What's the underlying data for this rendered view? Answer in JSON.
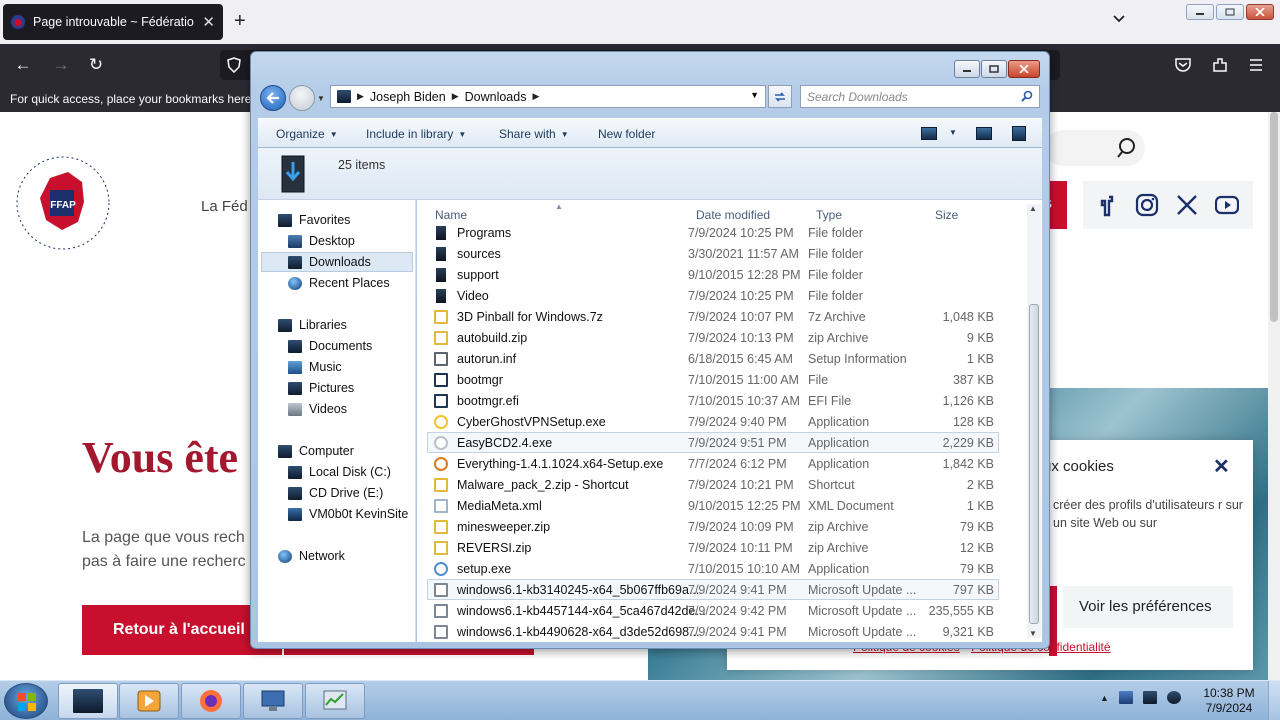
{
  "browser": {
    "tab_title": "Page introuvable ~ Fédération f",
    "tab_close": "✕",
    "new_tab": "+",
    "bookmark_hint": "For quick access, place your bookmarks here o"
  },
  "webpage": {
    "tagline": "La Féd",
    "top_red_button": "s",
    "hero_title": "Vous ête",
    "hero_text": "La page que vous rech pas à faire une recherc",
    "home_button": "Retour à l'accueil",
    "cookie": {
      "title": "ux cookies",
      "close": "✕",
      "text": "créer des profils d'utilisateurs r sur un site Web ou sur",
      "preferences_button": "Voir les préférences",
      "link_cookies": "Politique de cookies",
      "link_privacy": "Politique de confidentialité"
    }
  },
  "explorer": {
    "breadcrumb": [
      "Joseph Biden",
      "Downloads"
    ],
    "search_placeholder": "Search Downloads",
    "toolbar": {
      "organize": "Organize",
      "include_in_library": "Include in library",
      "share_with": "Share with",
      "new_folder": "New folder"
    },
    "item_count": "25 items",
    "nav": {
      "favorites": "Favorites",
      "desktop": "Desktop",
      "downloads": "Downloads",
      "recent_places": "Recent Places",
      "libraries": "Libraries",
      "documents": "Documents",
      "music": "Music",
      "pictures": "Pictures",
      "videos": "Videos",
      "computer": "Computer",
      "local_disk": "Local Disk (C:)",
      "cd_drive": "CD Drive (E:)",
      "vm": "VM0b0t KevinSite",
      "network": "Network"
    },
    "columns": {
      "name": "Name",
      "date": "Date modified",
      "type": "Type",
      "size": "Size"
    },
    "files": [
      {
        "name": "Programs",
        "date": "7/9/2024 10:25 PM",
        "type": "File folder",
        "size": "",
        "icon": "folder-icon"
      },
      {
        "name": "sources",
        "date": "3/30/2021 11:57 AM",
        "type": "File folder",
        "size": "",
        "icon": "folder-icon"
      },
      {
        "name": "support",
        "date": "9/10/2015 12:28 PM",
        "type": "File folder",
        "size": "",
        "icon": "folder-icon"
      },
      {
        "name": "Video",
        "date": "7/9/2024 10:25 PM",
        "type": "File folder",
        "size": "",
        "icon": "folder-icon"
      },
      {
        "name": "3D Pinball for Windows.7z",
        "date": "7/9/2024 10:07 PM",
        "type": "7z Archive",
        "size": "1,048 KB",
        "icon": "archive-icon"
      },
      {
        "name": "autobuild.zip",
        "date": "7/9/2024 10:13 PM",
        "type": "zip Archive",
        "size": "9 KB",
        "icon": "archive-icon"
      },
      {
        "name": "autorun.inf",
        "date": "6/18/2015 6:45 AM",
        "type": "Setup Information",
        "size": "1 KB",
        "icon": "settings-file-icon"
      },
      {
        "name": "bootmgr",
        "date": "7/10/2015 11:00 AM",
        "type": "File",
        "size": "387 KB",
        "icon": "file-icon"
      },
      {
        "name": "bootmgr.efi",
        "date": "7/10/2015 10:37 AM",
        "type": "EFI File",
        "size": "1,126 KB",
        "icon": "file-icon"
      },
      {
        "name": "CyberGhostVPNSetup.exe",
        "date": "7/9/2024 9:40 PM",
        "type": "Application",
        "size": "128 KB",
        "icon": "ghost-app-icon"
      },
      {
        "name": "EasyBCD2.4.exe",
        "date": "7/9/2024 9:51 PM",
        "type": "Application",
        "size": "2,229 KB",
        "icon": "app-icon"
      },
      {
        "name": "Everything-1.4.1.1024.x64-Setup.exe",
        "date": "7/7/2024 6:12 PM",
        "type": "Application",
        "size": "1,842 KB",
        "icon": "magnifier-app-icon"
      },
      {
        "name": "Malware_pack_2.zip - Shortcut",
        "date": "7/9/2024 10:21 PM",
        "type": "Shortcut",
        "size": "2 KB",
        "icon": "shortcut-icon"
      },
      {
        "name": "MediaMeta.xml",
        "date": "9/10/2015 12:25 PM",
        "type": "XML Document",
        "size": "1 KB",
        "icon": "xml-file-icon"
      },
      {
        "name": "minesweeper.zip",
        "date": "7/9/2024 10:09 PM",
        "type": "zip Archive",
        "size": "79 KB",
        "icon": "archive-icon"
      },
      {
        "name": "REVERSI.zip",
        "date": "7/9/2024 10:11 PM",
        "type": "zip Archive",
        "size": "12 KB",
        "icon": "archive-icon"
      },
      {
        "name": "setup.exe",
        "date": "7/10/2015 10:10 AM",
        "type": "Application",
        "size": "79 KB",
        "icon": "setup-app-icon"
      },
      {
        "name": "windows6.1-kb3140245-x64_5b067ffb69a...",
        "date": "7/9/2024 9:41 PM",
        "type": "Microsoft Update ...",
        "size": "797 KB",
        "icon": "update-package-icon"
      },
      {
        "name": "windows6.1-kb4457144-x64_5ca467d42de...",
        "date": "7/9/2024 9:42 PM",
        "type": "Microsoft Update ...",
        "size": "235,555 KB",
        "icon": "update-package-icon"
      },
      {
        "name": "windows6.1-kb4490628-x64_d3de52d698...",
        "date": "7/9/2024 9:41 PM",
        "type": "Microsoft Update ...",
        "size": "9,321 KB",
        "icon": "update-package-icon"
      }
    ]
  },
  "taskbar": {
    "time": "10:38 PM",
    "date": "7/9/2024"
  },
  "colors": {
    "brand_red": "#c8102e",
    "brand_blue": "#1b2f6b",
    "folder_icon": "#2a3e58"
  }
}
